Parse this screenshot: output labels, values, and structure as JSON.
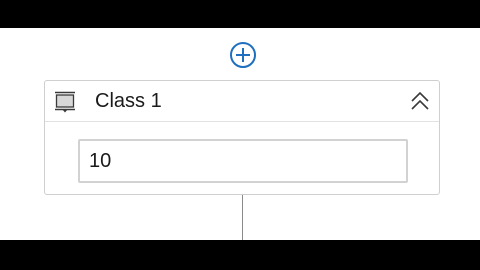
{
  "colors": {
    "letterbox": "#000000",
    "canvas": "#ffffff",
    "accent": "#1f6fbf",
    "border": "#cfcfcf"
  },
  "designer": {
    "add_button_icon": "plus-circle-icon",
    "activity": {
      "icon": "container-activity-icon",
      "title": "Class 1",
      "collapse_icon": "double-chevron-up-icon",
      "input": {
        "value": "10",
        "placeholder": ""
      }
    }
  }
}
